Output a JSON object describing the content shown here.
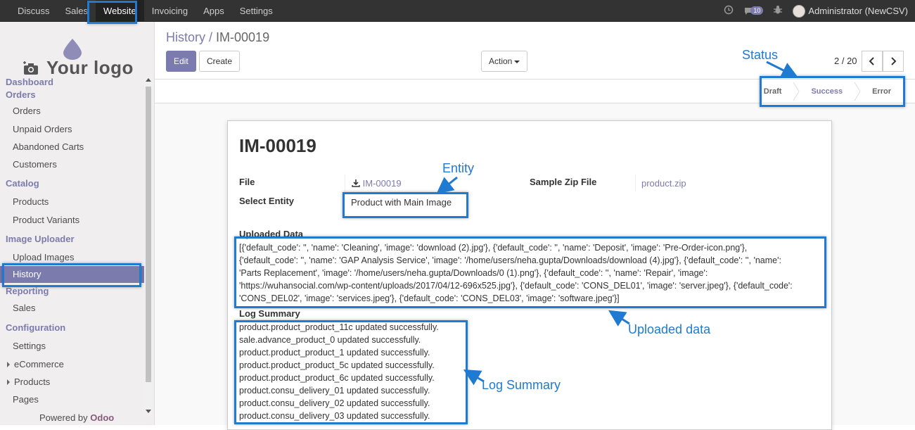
{
  "topbar": {
    "menu": [
      "Discuss",
      "Sales",
      "Website",
      "Invoicing",
      "Apps",
      "Settings"
    ],
    "active": "Website",
    "message_count": "10",
    "user": "Administrator (NewCSV)"
  },
  "sidebar": {
    "logo_text": "Your logo",
    "sections": [
      {
        "title": "Dashboard",
        "items": []
      },
      {
        "title": "Orders",
        "items": [
          "Orders",
          "Unpaid Orders",
          "Abandoned Carts",
          "Customers"
        ]
      },
      {
        "title": "Catalog",
        "items": [
          "Products",
          "Product Variants"
        ]
      },
      {
        "title": "Image Uploader",
        "items": [
          "Upload Images",
          "History"
        ]
      },
      {
        "title": "Reporting",
        "items": [
          "Sales"
        ]
      },
      {
        "title": "Configuration",
        "items": [
          "Settings",
          "eCommerce",
          "Products",
          "Pages"
        ]
      }
    ],
    "selected": "History",
    "powered_by": "Powered by",
    "powered_brand": "Odoo"
  },
  "control_panel": {
    "breadcrumb_parent": "History /",
    "breadcrumb_current": "IM-00019",
    "edit_label": "Edit",
    "create_label": "Create",
    "action_label": "Action",
    "pager": "2 / 20"
  },
  "status": {
    "stages": [
      "Draft",
      "Success",
      "Error"
    ],
    "active": "Success"
  },
  "record": {
    "title": "IM-00019",
    "file_label": "File",
    "file_value": "IM-00019",
    "sample_zip_label": "Sample Zip File",
    "sample_zip_value": "product.zip",
    "entity_label": "Select Entity",
    "entity_value": "Product with Main Image",
    "uploaded_label": "Uploaded Data",
    "uploaded_lines": [
      "[{'default_code': '', 'name': 'Cleaning', 'image': 'download (2).jpg'}, {'default_code': '', 'name': 'Deposit', 'image': 'Pre-Order-icon.png'},",
      "{'default_code': '', 'name': 'GAP Analysis Service', 'image': '/home/users/neha.gupta/Downloads/download (4).jpg'}, {'default_code': '', 'name':",
      "'Parts Replacement', 'image': '/home/users/neha.gupta/Downloads/0 (1).png'}, {'default_code': '', 'name': 'Repair', 'image':",
      "'https://wuhansocial.com/wp-content/uploads/2017/04/12-696x525.jpg'}, {'default_code': 'CONS_DEL01', 'image': 'server.jpeg'}, {'default_code':",
      "'CONS_DEL02', 'image': 'services.jpeg'}, {'default_code': 'CONS_DEL03', 'image': 'software.jpeg'}]"
    ],
    "log_label": "Log Summary",
    "log_lines": [
      "product.product_product_11c updated successfully.",
      "sale.advance_product_0 updated successfully.",
      "product.product_product_1 updated successfully.",
      "product.product_product_5c updated successfully.",
      "product.product_product_6c updated successfully.",
      "product.consu_delivery_01 updated successfully.",
      "product.consu_delivery_02 updated successfully.",
      "product.consu_delivery_03 updated successfully."
    ]
  },
  "annotations": {
    "status": "Status",
    "entity": "Entity",
    "uploaded": "Uploaded data",
    "log": "Log Summary",
    "color": "#1f7ad2"
  }
}
